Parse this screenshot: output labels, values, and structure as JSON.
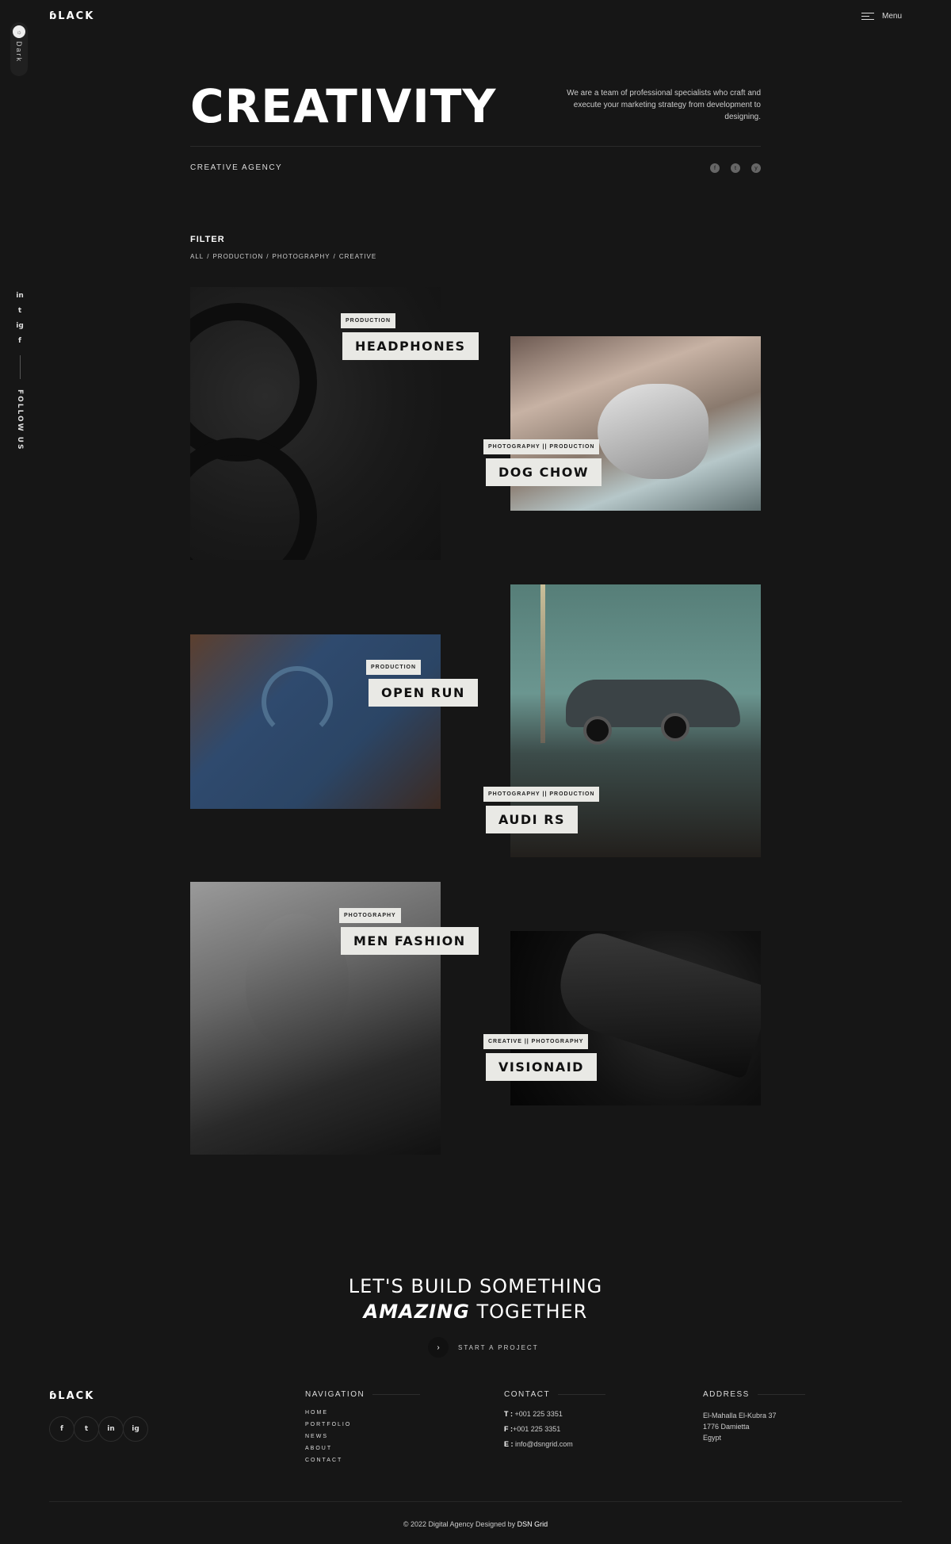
{
  "header": {
    "logo": "ɓLACK",
    "menu_label": "Menu"
  },
  "theme_toggle": {
    "label": "Dark",
    "knob_icon": "☼"
  },
  "side_social": {
    "items": [
      "in",
      "t",
      "ig",
      "f"
    ],
    "follow_label": "FOLLOW US"
  },
  "hero": {
    "title": "CREATIVITY",
    "description": "We are a team of professional specialists who craft and execute your marketing strategy from development to designing.",
    "subtitle": "CREATIVE AGENCY",
    "social": [
      "f",
      "t",
      "y"
    ]
  },
  "filter": {
    "title": "FILTER",
    "items": [
      "ALL",
      "PRODUCTION",
      "PHOTOGRAPHY",
      "CREATIVE"
    ],
    "separator": "/"
  },
  "portfolio": [
    {
      "title": "HEADPHONES",
      "tags": "PRODUCTION"
    },
    {
      "title": "DOG CHOW",
      "tags": "PHOTOGRAPHY || PRODUCTION"
    },
    {
      "title": "OPEN RUN",
      "tags": "PRODUCTION"
    },
    {
      "title": "AUDI RS",
      "tags": "PHOTOGRAPHY || PRODUCTION"
    },
    {
      "title": "MEN FASHION",
      "tags": "PHOTOGRAPHY"
    },
    {
      "title": "VISIONAID",
      "tags": "CREATIVE || PHOTOGRAPHY"
    }
  ],
  "cta": {
    "line1": "LET'S BUILD SOMETHING",
    "line2_em": "AMAZING",
    "line2_rest": "TOGETHER",
    "button_label": "START A PROJECT",
    "button_icon": "›"
  },
  "footer": {
    "logo": "ɓLACK",
    "social": [
      "f",
      "t",
      "in",
      "ig"
    ],
    "navigation": {
      "title": "NAVIGATION",
      "items": [
        "HOME",
        "PORTFOLIO",
        "NEWS",
        "ABOUT",
        "CONTACT"
      ]
    },
    "contact": {
      "title": "CONTACT",
      "phone_label": "T :",
      "phone": "+001 225 3351",
      "fax_label": "F :",
      "fax": "+001 225 3351",
      "email_label": "E :",
      "email": "info@dsngrid.com"
    },
    "address": {
      "title": "ADDRESS",
      "line1": "El-Mahalla El-Kubra 37",
      "line2": "1776 Damietta",
      "line3": "Egypt"
    },
    "copyright": "© 2022 Digital Agency Designed by",
    "copyright_brand": "DSN Grid"
  }
}
